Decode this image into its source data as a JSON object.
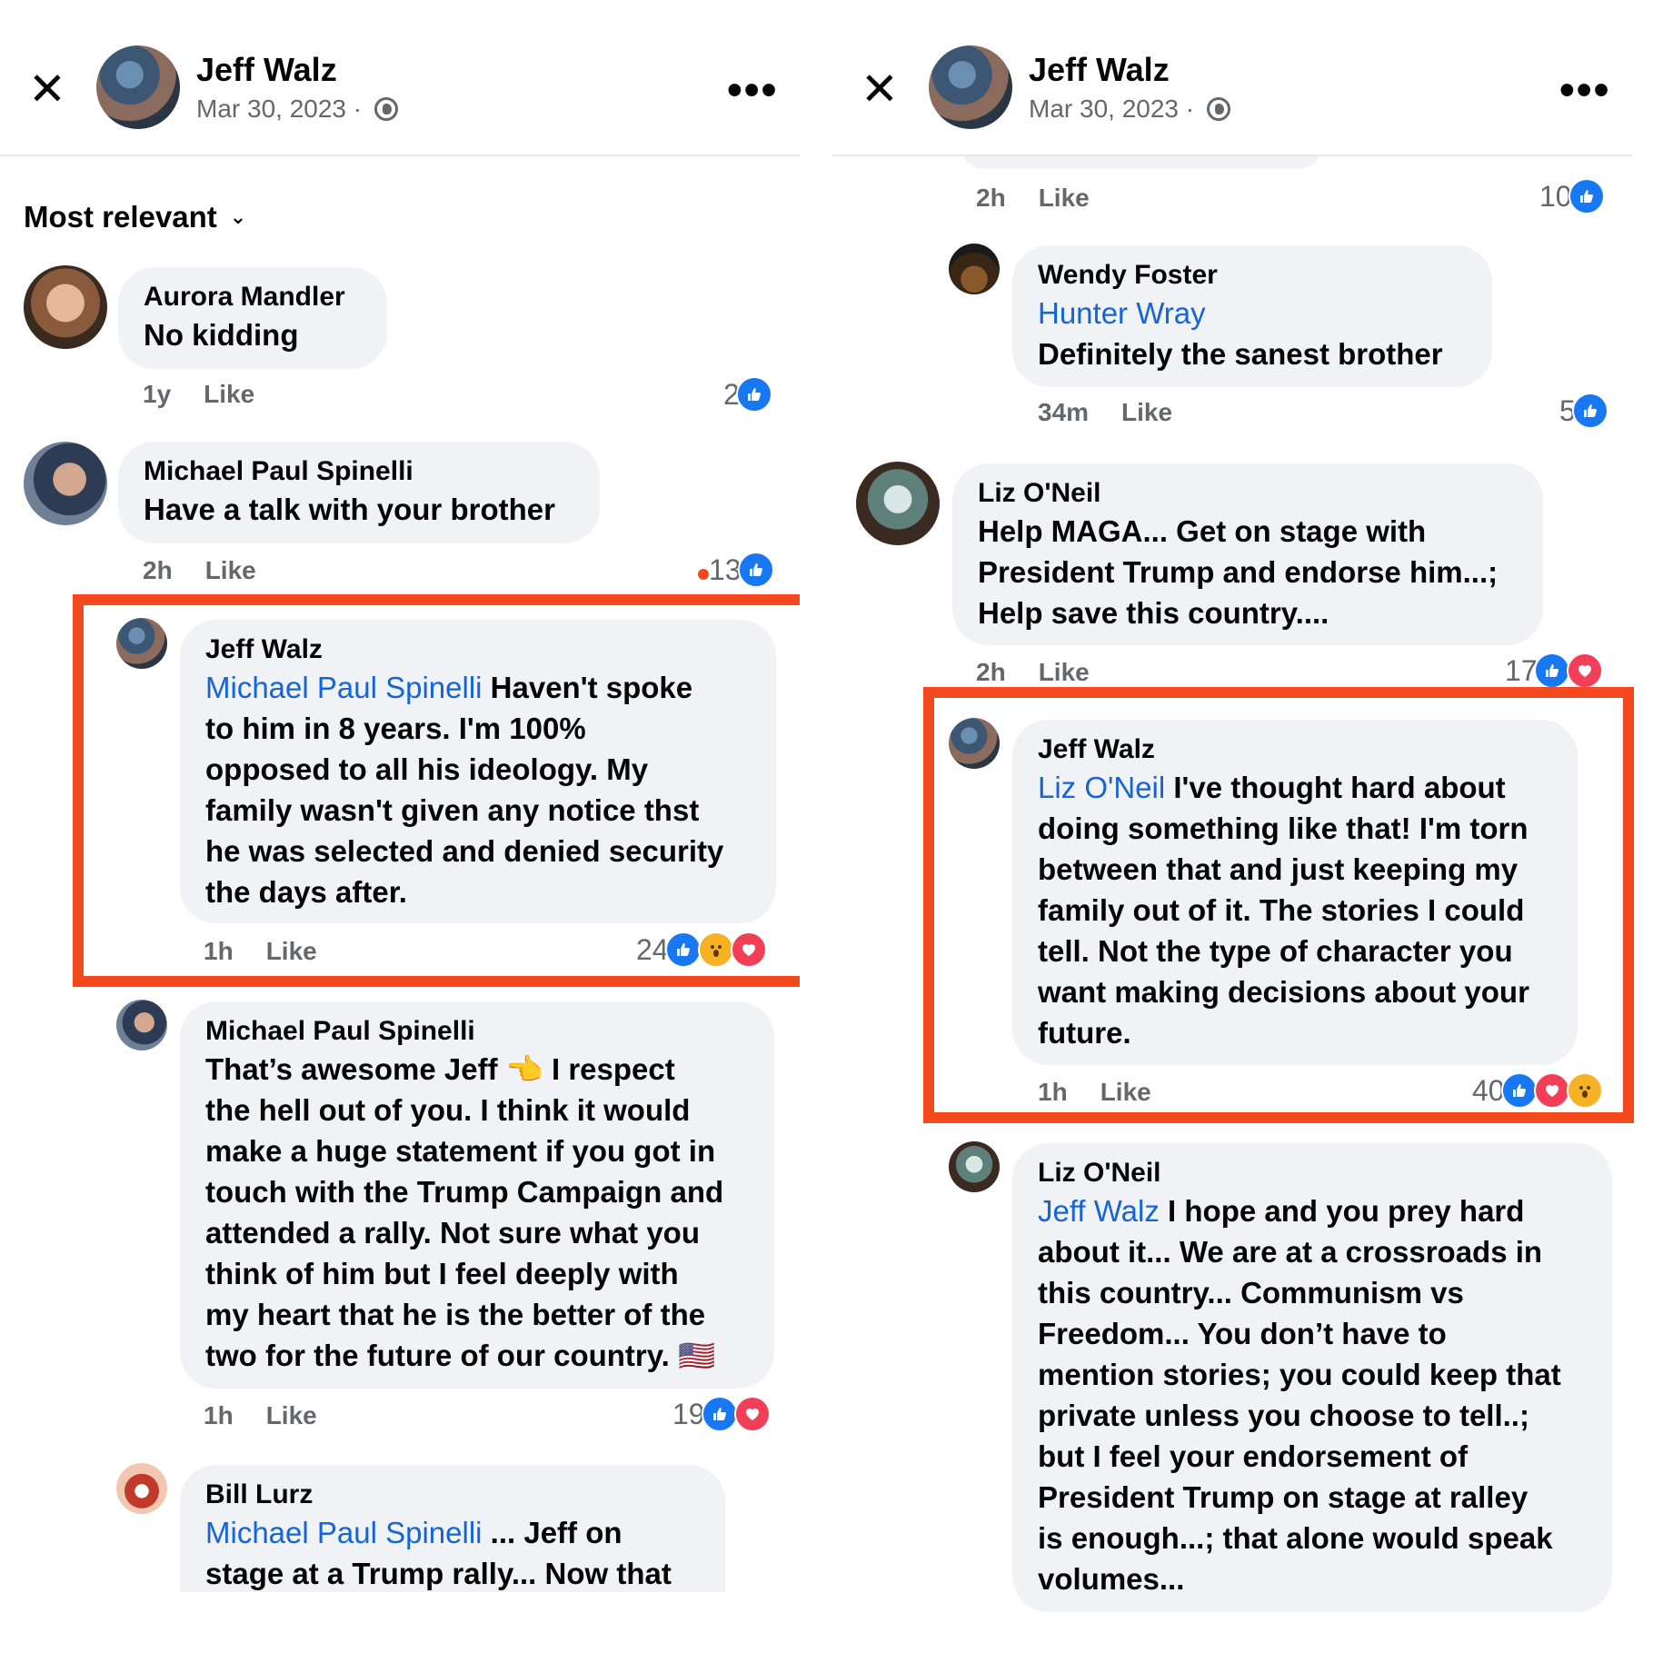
{
  "header": {
    "name": "Jeff Walz",
    "date": "Mar 30, 2023 · "
  },
  "left": {
    "sort_label": "Most relevant",
    "comments": [
      {
        "name": "Aurora Mandler",
        "text": "No kidding",
        "time": "1y",
        "like": "Like",
        "count": "2"
      },
      {
        "name": "Michael Paul Spinelli",
        "text": "Have a talk with your brother",
        "time": "2h",
        "like": "Like",
        "count": "13"
      },
      {
        "name": "Jeff Walz",
        "mention": "Michael Paul Spinelli",
        "text": " Haven't spoke\nto him in 8 years.  I'm 100%\nopposed to all his ideology.  My\nfamily wasn't given any notice thst\nhe was selected and denied security\nthe days after.",
        "time": "1h",
        "like": "Like",
        "count": "24"
      },
      {
        "name": "Michael Paul Spinelli",
        "text": "That’s awesome Jeff 👈 I respect\nthe hell out of you. I think it would\nmake a huge statement if you got in\ntouch with the Trump Campaign and\nattended a rally. Not sure what you\nthink of him but I feel deeply with\nmy heart that he is the better of the\ntwo for the future of our country. 🇺🇸",
        "time": "1h",
        "like": "Like",
        "count": "19"
      },
      {
        "name": "Bill Lurz",
        "mention": "Michael Paul Spinelli",
        "text": " ... Jeff on\nstage at a Trump rally... Now that"
      }
    ]
  },
  "right": {
    "top_meta": {
      "time": "2h",
      "like": "Like",
      "count": "10"
    },
    "comments": [
      {
        "name": "Wendy Foster",
        "mention": "Hunter Wray",
        "text": "Definitely the sanest brother",
        "time": "34m",
        "like": "Like",
        "count": "5"
      },
      {
        "name": "Liz O'Neil",
        "text": "Help MAGA... Get on stage with\nPresident Trump and endorse him...;\nHelp save this country....",
        "time": "2h",
        "like": "Like",
        "count": "17"
      },
      {
        "name": "Jeff Walz",
        "mention": "Liz O'Neil",
        "text": " I've thought hard about\ndoing something like that! I'm torn\nbetween that and just keeping my\nfamily out of it. The stories I could\ntell. Not the type of character you\nwant making decisions about your\nfuture.",
        "time": "1h",
        "like": "Like",
        "count": "40"
      },
      {
        "name": "Liz O'Neil",
        "mention": "Jeff Walz",
        "text": " I hope and you prey hard\nabout it... We are at a crossroads in\nthis country... Communism vs\nFreedom... You don’t have to\nmention stories; you could keep that\nprivate unless you choose to tell..;\nbut I feel your endorsement of\nPresident Trump on stage at ralley\nis enough...; that alone would speak\nvolumes..."
      }
    ]
  },
  "colors": {
    "highlight": "#f4481e",
    "mention": "#1564d9",
    "bubble": "#f0f2f5",
    "like": "#1877f2",
    "love": "#f33e58",
    "wow": "#f7b125"
  }
}
